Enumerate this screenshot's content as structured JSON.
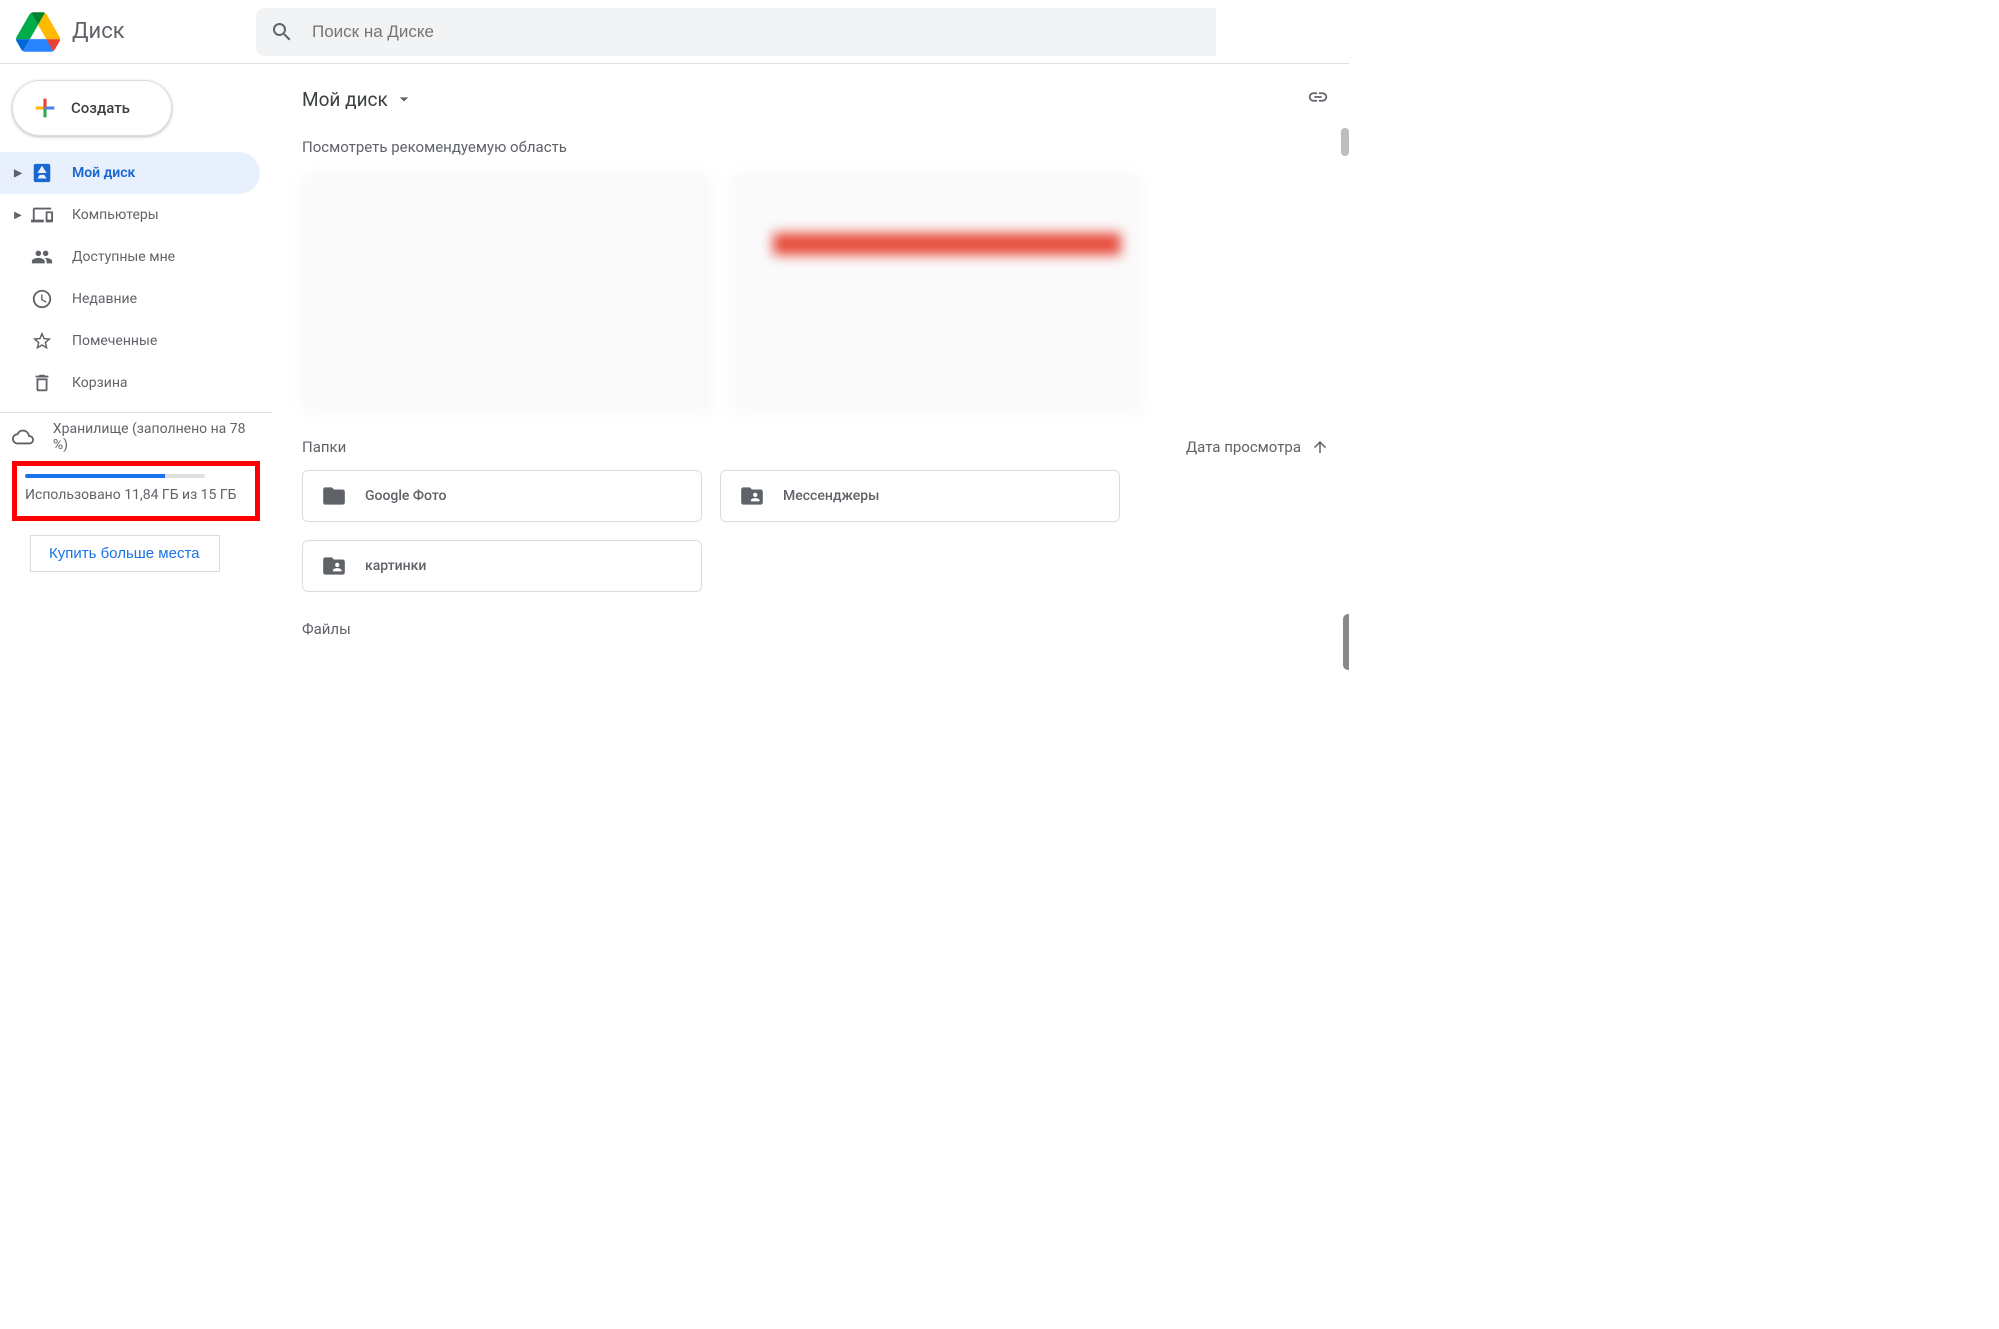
{
  "header": {
    "app_name": "Диск",
    "search_placeholder": "Поиск на Диске"
  },
  "sidebar": {
    "create_label": "Создать",
    "items": [
      {
        "label": "Мой диск",
        "icon": "drive",
        "expandable": true,
        "active": true
      },
      {
        "label": "Компьютеры",
        "icon": "devices",
        "expandable": true,
        "active": false
      },
      {
        "label": "Доступные мне",
        "icon": "shared",
        "expandable": false,
        "active": false
      },
      {
        "label": "Недавние",
        "icon": "recent",
        "expandable": false,
        "active": false
      },
      {
        "label": "Помеченные",
        "icon": "starred",
        "expandable": false,
        "active": false
      },
      {
        "label": "Корзина",
        "icon": "trash",
        "expandable": false,
        "active": false
      }
    ],
    "storage": {
      "title": "Хранилище (заполнено на 78 %)",
      "percent": 78,
      "used_text": "Использовано 11,84 ГБ из 15 ГБ",
      "buy_label": "Купить больше места"
    }
  },
  "main": {
    "breadcrumb": "Мой диск",
    "suggested_title": "Посмотреть рекомендуемую область",
    "folders_title": "Папки",
    "sort_label": "Дата просмотра",
    "folders": [
      {
        "name": "Google Фото",
        "shared": false
      },
      {
        "name": "Мессенджеры",
        "shared": true
      },
      {
        "name": "картинки",
        "shared": true
      }
    ],
    "files_title": "Файлы"
  }
}
